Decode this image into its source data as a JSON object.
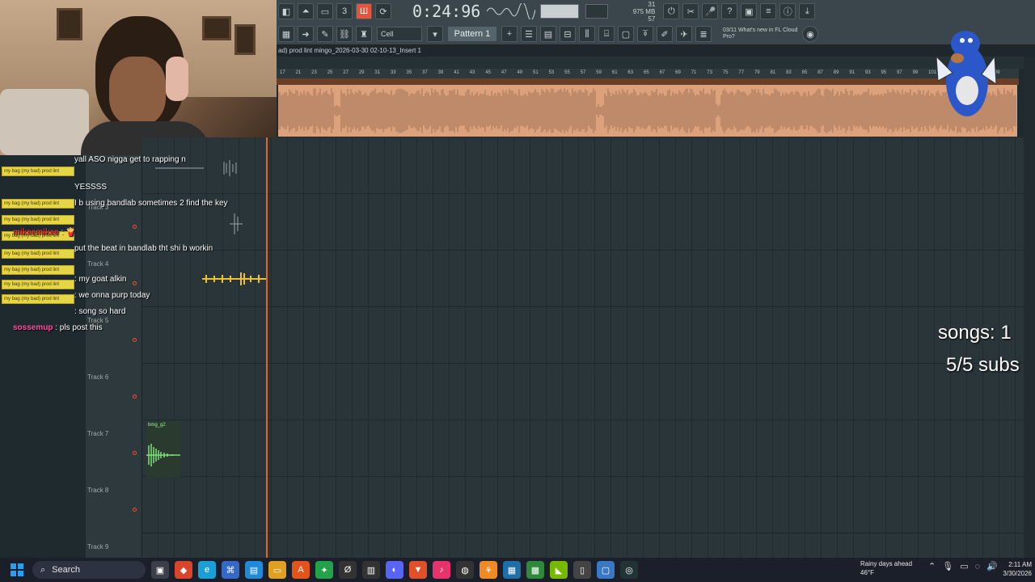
{
  "toolbar": {
    "time": "0:24:96",
    "time_unit": "M:S:CS",
    "cpu_memory": "975 MB",
    "cpu_load": "57",
    "voices": "31",
    "pattern_label": "Pattern 1",
    "snap_label": "Cell",
    "news_text": "What's new in FL Cloud Pro?",
    "news_date": "03/11"
  },
  "window": {
    "title": "ad) prod lint mingo_2026-03-30 02-10-13_Insert 1"
  },
  "ruler": {
    "marks": [
      "17",
      "21",
      "23",
      "25",
      "27",
      "29",
      "31",
      "33",
      "35",
      "37",
      "39",
      "41",
      "43",
      "45",
      "47",
      "49",
      "51",
      "53",
      "55",
      "57",
      "59",
      "61",
      "63",
      "65",
      "67",
      "69",
      "71",
      "73",
      "75",
      "77",
      "79",
      "81",
      "83",
      "85",
      "87",
      "89",
      "91",
      "93",
      "95",
      "97",
      "99",
      "101",
      "103",
      "105",
      "107",
      "109"
    ]
  },
  "tracks": [
    {
      "label": "Track 3"
    },
    {
      "label": "Track 4"
    },
    {
      "label": "Track 5"
    },
    {
      "label": "Track 6"
    },
    {
      "label": "Track 7"
    },
    {
      "label": "Track 8"
    },
    {
      "label": "Track 9"
    }
  ],
  "clips": {
    "track7_label": "bmg_g2"
  },
  "chat": {
    "lines": [
      {
        "user": "",
        "text": "yall ASO nigga get to rapping n"
      },
      {
        "user": "",
        "text": "YESSSS"
      },
      {
        "user": "",
        "text": "I b using bandlab sometimes 2 find the key"
      },
      {
        "user": "mikeemikee",
        "text": ": 🍟"
      },
      {
        "user": "",
        "text": "put the beat in bandlab tht shi b workin"
      },
      {
        "user": "",
        "text": ": my goat alkin"
      },
      {
        "user": "",
        "text": ": we onna purp today"
      },
      {
        "user": "",
        "text": ": song so hard"
      },
      {
        "user": "sossemup",
        "text": ": pls post this"
      }
    ],
    "badge_text": "my bag (my bad) prod lint"
  },
  "overlay": {
    "songs": "songs: 1",
    "subs": "5/5 subs"
  },
  "taskbar": {
    "search_label": "Search",
    "weather_title": "Rainy days ahead",
    "weather_temp": "46°F",
    "time": "2:11 AM",
    "date": "3/30/2026"
  },
  "colors": {
    "audio_clip": "#dda27c",
    "playhead": "#e4661f",
    "toolbar_bg": "#3a464c"
  }
}
